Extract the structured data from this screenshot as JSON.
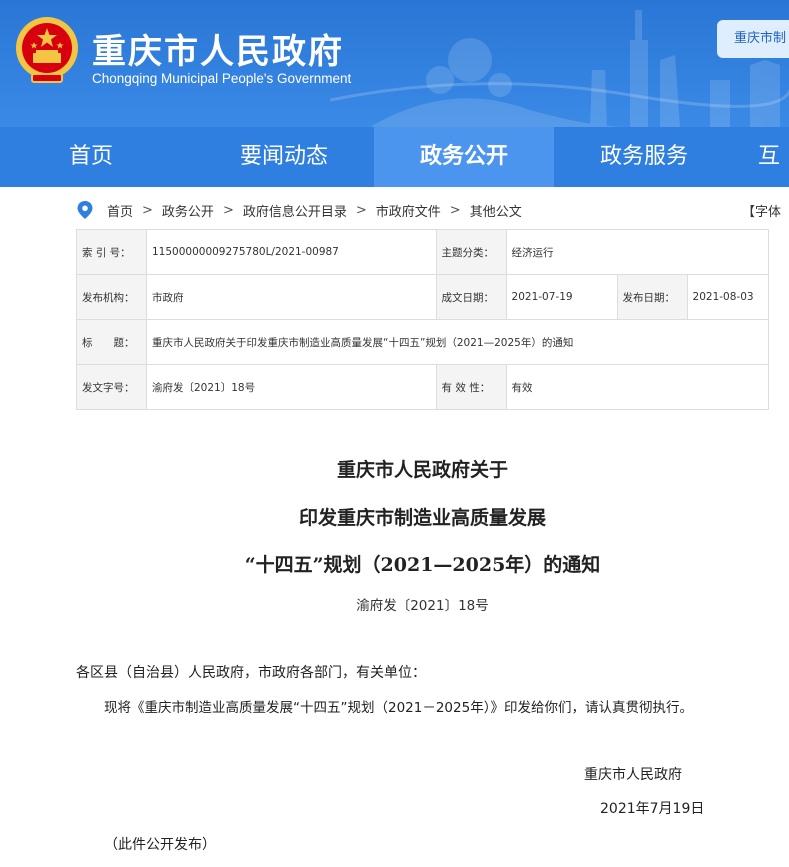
{
  "header": {
    "title": "重庆市人民政府",
    "subtitle": "Chongqing Municipal People's Government",
    "top_button": "重庆市制"
  },
  "nav": {
    "items": [
      {
        "label": "首页",
        "active": false
      },
      {
        "label": "要闻动态",
        "active": false
      },
      {
        "label": "政务公开",
        "active": true
      },
      {
        "label": "政务服务",
        "active": false
      },
      {
        "label": "互",
        "active": false
      }
    ]
  },
  "breadcrumb": {
    "items": [
      "首页",
      "政务公开",
      "政府信息公开目录",
      "市政府文件",
      "其他公文"
    ],
    "separator": ">",
    "font_label": "【字体"
  },
  "meta": {
    "index_label": "索 引 号：",
    "index_value": "11500000009275780L/2021-00987",
    "topic_label": "主题分类：",
    "topic_value": "经济运行",
    "issuer_label": "发布机构：",
    "issuer_value": "市政府",
    "created_label": "成文日期：",
    "created_value": "2021-07-19",
    "published_label": "发布日期：",
    "published_value": "2021-08-03",
    "title_label": "标　　题：",
    "title_value": "重庆市人民政府关于印发重庆市制造业高质量发展“十四五”规划（2021—2025年）的通知",
    "docno_label": "发文字号：",
    "docno_value": "渝府发〔2021〕18号",
    "validity_label": "有 效 性：",
    "validity_value": "有效"
  },
  "document": {
    "title_lines": [
      "重庆市人民政府关于",
      "印发重庆市制造业高质量发展",
      "“十四五”规划（2021—2025年）的通知"
    ],
    "doc_number": "渝府发〔2021〕18号",
    "recipients": "各区县（自治县）人民政府，市政府各部门，有关单位：",
    "body": "现将《重庆市制造业高质量发展“十四五”规划（2021－2025年）》印发给你们，请认真贯彻执行。",
    "signatory": "重庆市人民政府",
    "date": "2021年7月19日",
    "note": "（此件公开发布）"
  },
  "colors": {
    "banner": "#2a76d6",
    "nav": "#2f7fe0",
    "nav_active": "#4b95ee",
    "emblem_red": "#d7000f",
    "emblem_gold": "#f4c542"
  }
}
